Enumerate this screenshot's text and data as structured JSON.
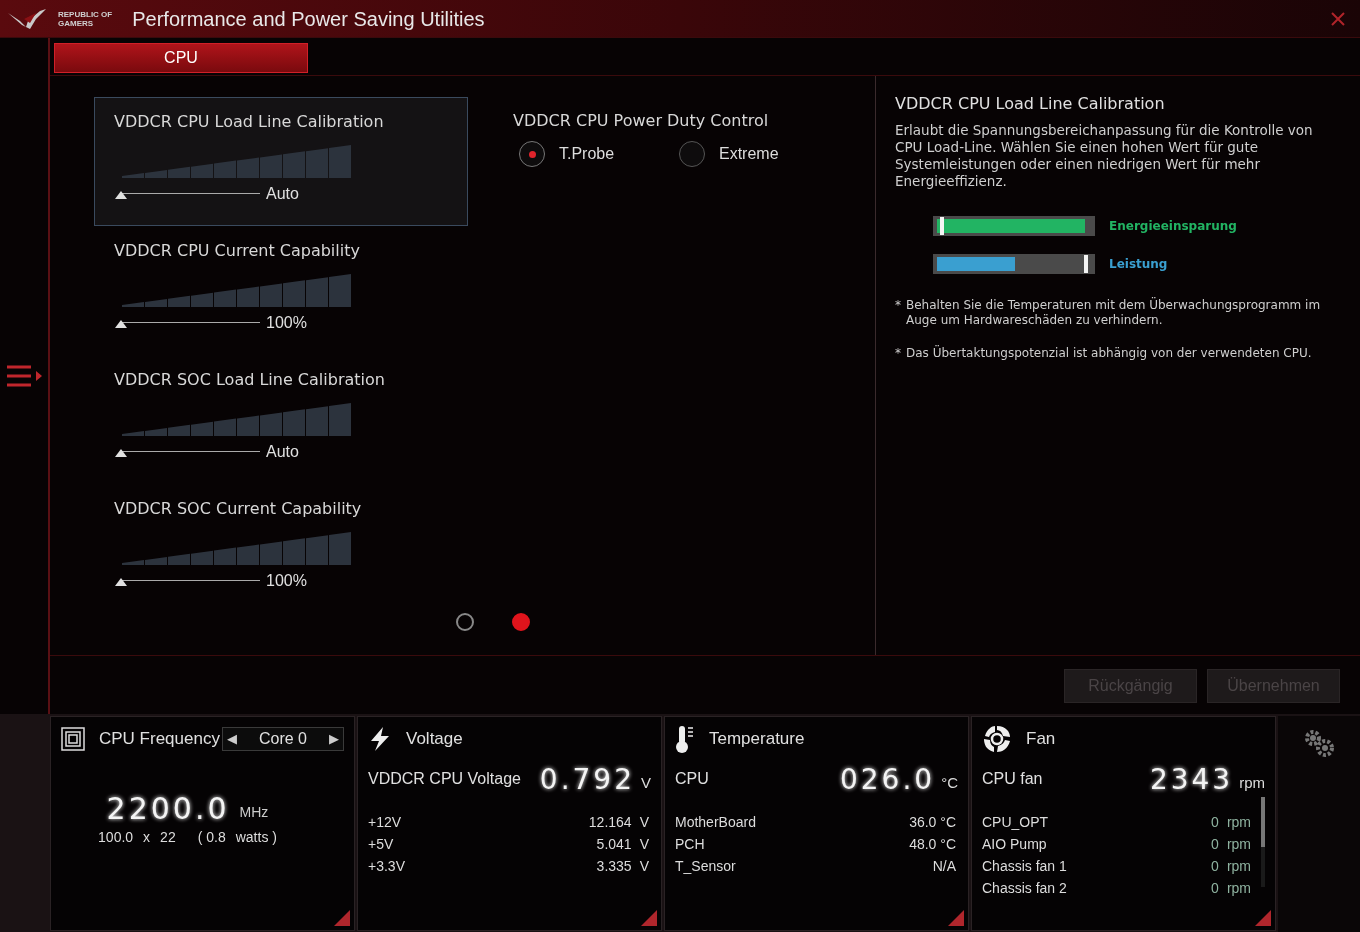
{
  "window": {
    "title": "Performance and Power Saving Utilities",
    "logo_text": [
      "REPUBLIC OF",
      "GAMERS"
    ]
  },
  "tabs": [
    {
      "label": "CPU",
      "selected": true
    }
  ],
  "settings": [
    {
      "title": "VDDCR CPU Load Line Calibration",
      "value": "Auto",
      "level": 0,
      "selected": true
    },
    {
      "title": "VDDCR CPU Current Capability",
      "value": "100%",
      "level": 0,
      "selected": false
    },
    {
      "title": "VDDCR SOC Load Line Calibration",
      "value": "Auto",
      "level": 0,
      "selected": false
    },
    {
      "title": "VDDCR SOC Current Capability",
      "value": "100%",
      "level": 0,
      "selected": false
    }
  ],
  "power_duty": {
    "title": "VDDCR CPU Power Duty Control",
    "options": [
      {
        "label": "T.Probe",
        "selected": true
      },
      {
        "label": "Extreme",
        "selected": false
      }
    ]
  },
  "pages": [
    {
      "selected": false
    },
    {
      "selected": true
    }
  ],
  "info": {
    "title": "VDDCR CPU Load Line Calibration",
    "description": "Erlaubt die Spannungsbereichanpassung für die Kontrolle von CPU Load-Line. Wählen Sie einen hohen Wert für gute Systemleistungen oder einen niedrigen Wert für mehr Energieeffizienz.",
    "legend": [
      {
        "kind": "saving",
        "label": "Energieeinsparung",
        "color": "#22b463"
      },
      {
        "kind": "performance",
        "label": "Leistung",
        "color": "#3a9fd0"
      }
    ],
    "notes": [
      {
        "mark": "*",
        "text": "Behalten Sie die Temperaturen mit dem Überwachungsprogramm im Auge um Hardwareschäden zu verhindern."
      },
      {
        "mark": "*",
        "text": "Das Übertaktungspotenzial ist abhängig von der verwendeten CPU."
      }
    ]
  },
  "buttons": [
    {
      "label": "Rückgängig",
      "disabled": true
    },
    {
      "label": "Übernehmen",
      "disabled": true
    }
  ],
  "monitor": [
    {
      "kind": "frequency",
      "title": "CPU Frequency",
      "core": {
        "prev": "◀",
        "label": "Core 0",
        "next": "▶"
      },
      "big_value": "2200.0",
      "unit": "MHz",
      "detail": [
        "100.0",
        "x",
        "22",
        "( 0.8",
        "watts )"
      ]
    },
    {
      "kind": "voltage",
      "title": "Voltage",
      "main_label": "VDDCR CPU Voltage",
      "big_value": "0.792",
      "unit": "V",
      "rows": [
        {
          "label": "+12V",
          "value": "12.164",
          "unit": "V"
        },
        {
          "label": "+5V",
          "value": "5.041",
          "unit": "V"
        },
        {
          "label": "+3.3V",
          "value": "3.335",
          "unit": "V"
        }
      ]
    },
    {
      "kind": "temperature",
      "title": "Temperature",
      "main_label": "CPU",
      "big_value": "026.0",
      "unit": "°C",
      "rows": [
        {
          "label": "MotherBoard",
          "value": "36.0 °C"
        },
        {
          "label": "PCH",
          "value": "48.0 °C"
        },
        {
          "label": "T_Sensor",
          "value": "N/A"
        }
      ]
    },
    {
      "kind": "fan",
      "title": "Fan",
      "main_label": "CPU fan",
      "big_value": "2343",
      "unit": "rpm",
      "rows": [
        {
          "label": "CPU_OPT",
          "value": "0",
          "unit": "rpm"
        },
        {
          "label": "AIO Pump",
          "value": "0",
          "unit": "rpm"
        },
        {
          "label": "Chassis fan 1",
          "value": "0",
          "unit": "rpm"
        },
        {
          "label": "Chassis fan 2",
          "value": "0",
          "unit": "rpm"
        }
      ]
    }
  ]
}
